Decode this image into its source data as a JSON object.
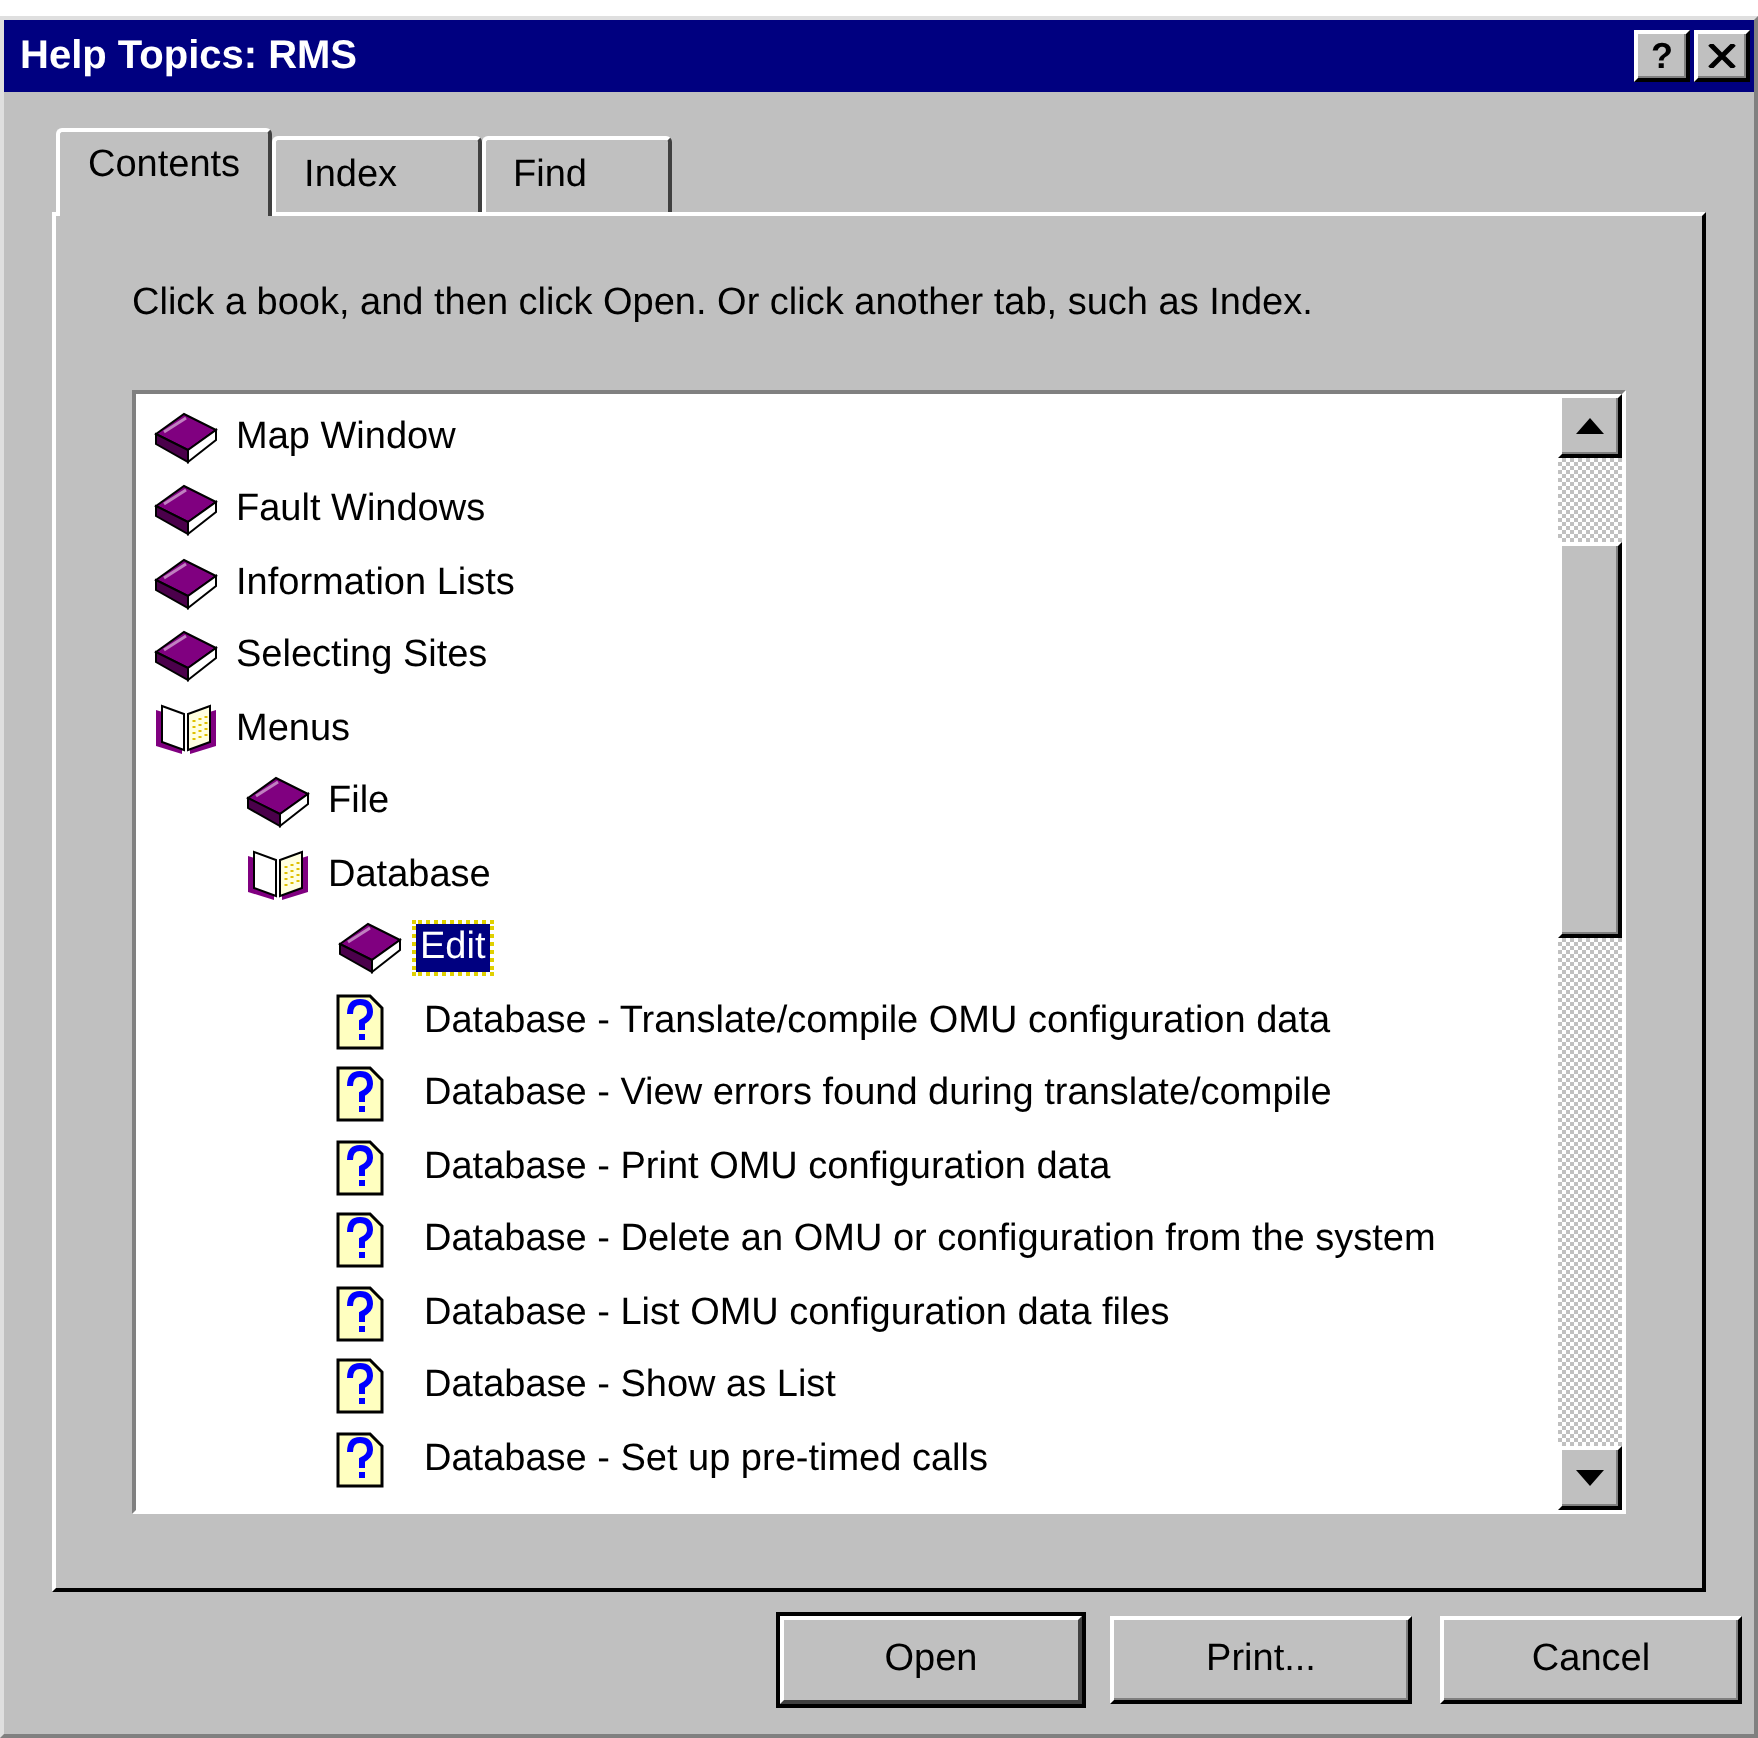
{
  "window": {
    "title": "Help Topics: RMS",
    "help_button": "?"
  },
  "tabs": [
    {
      "label": "Contents",
      "selected": true
    },
    {
      "label": "Index",
      "selected": false
    },
    {
      "label": "Find",
      "selected": false
    }
  ],
  "instruction": "Click a book, and then click Open. Or click another tab, such as Index.",
  "tree": [
    {
      "kind": "book",
      "label": "Map Window",
      "expanded": false,
      "selected": false
    },
    {
      "kind": "book",
      "label": "Fault Windows",
      "expanded": false,
      "selected": false
    },
    {
      "kind": "book",
      "label": "Information Lists",
      "expanded": false,
      "selected": false
    },
    {
      "kind": "book",
      "label": "Selecting Sites",
      "expanded": false,
      "selected": false
    },
    {
      "kind": "book",
      "label": "Menus",
      "expanded": true,
      "selected": false,
      "children": [
        {
          "kind": "book",
          "label": "File",
          "expanded": false,
          "selected": false
        },
        {
          "kind": "book",
          "label": "Database",
          "expanded": true,
          "selected": false,
          "children": [
            {
              "kind": "book",
              "label": "Edit",
              "expanded": false,
              "selected": true
            },
            {
              "kind": "topic",
              "label": "Database - Translate/compile OMU configuration data",
              "selected": false
            },
            {
              "kind": "topic",
              "label": "Database - View errors found during translate/compile",
              "selected": false
            },
            {
              "kind": "topic",
              "label": "Database - Print OMU configuration data",
              "selected": false
            },
            {
              "kind": "topic",
              "label": "Database - Delete an OMU or configuration from the system",
              "selected": false
            },
            {
              "kind": "topic",
              "label": "Database - List OMU configuration data files",
              "selected": false
            },
            {
              "kind": "topic",
              "label": "Database - Show as List",
              "selected": false
            },
            {
              "kind": "topic",
              "label": "Database - Set up pre-timed calls",
              "selected": false
            }
          ]
        }
      ]
    }
  ],
  "buttons": [
    {
      "label": "Open",
      "default": true
    },
    {
      "label": "Print...",
      "default": false
    },
    {
      "label": "Cancel",
      "default": false
    }
  ]
}
